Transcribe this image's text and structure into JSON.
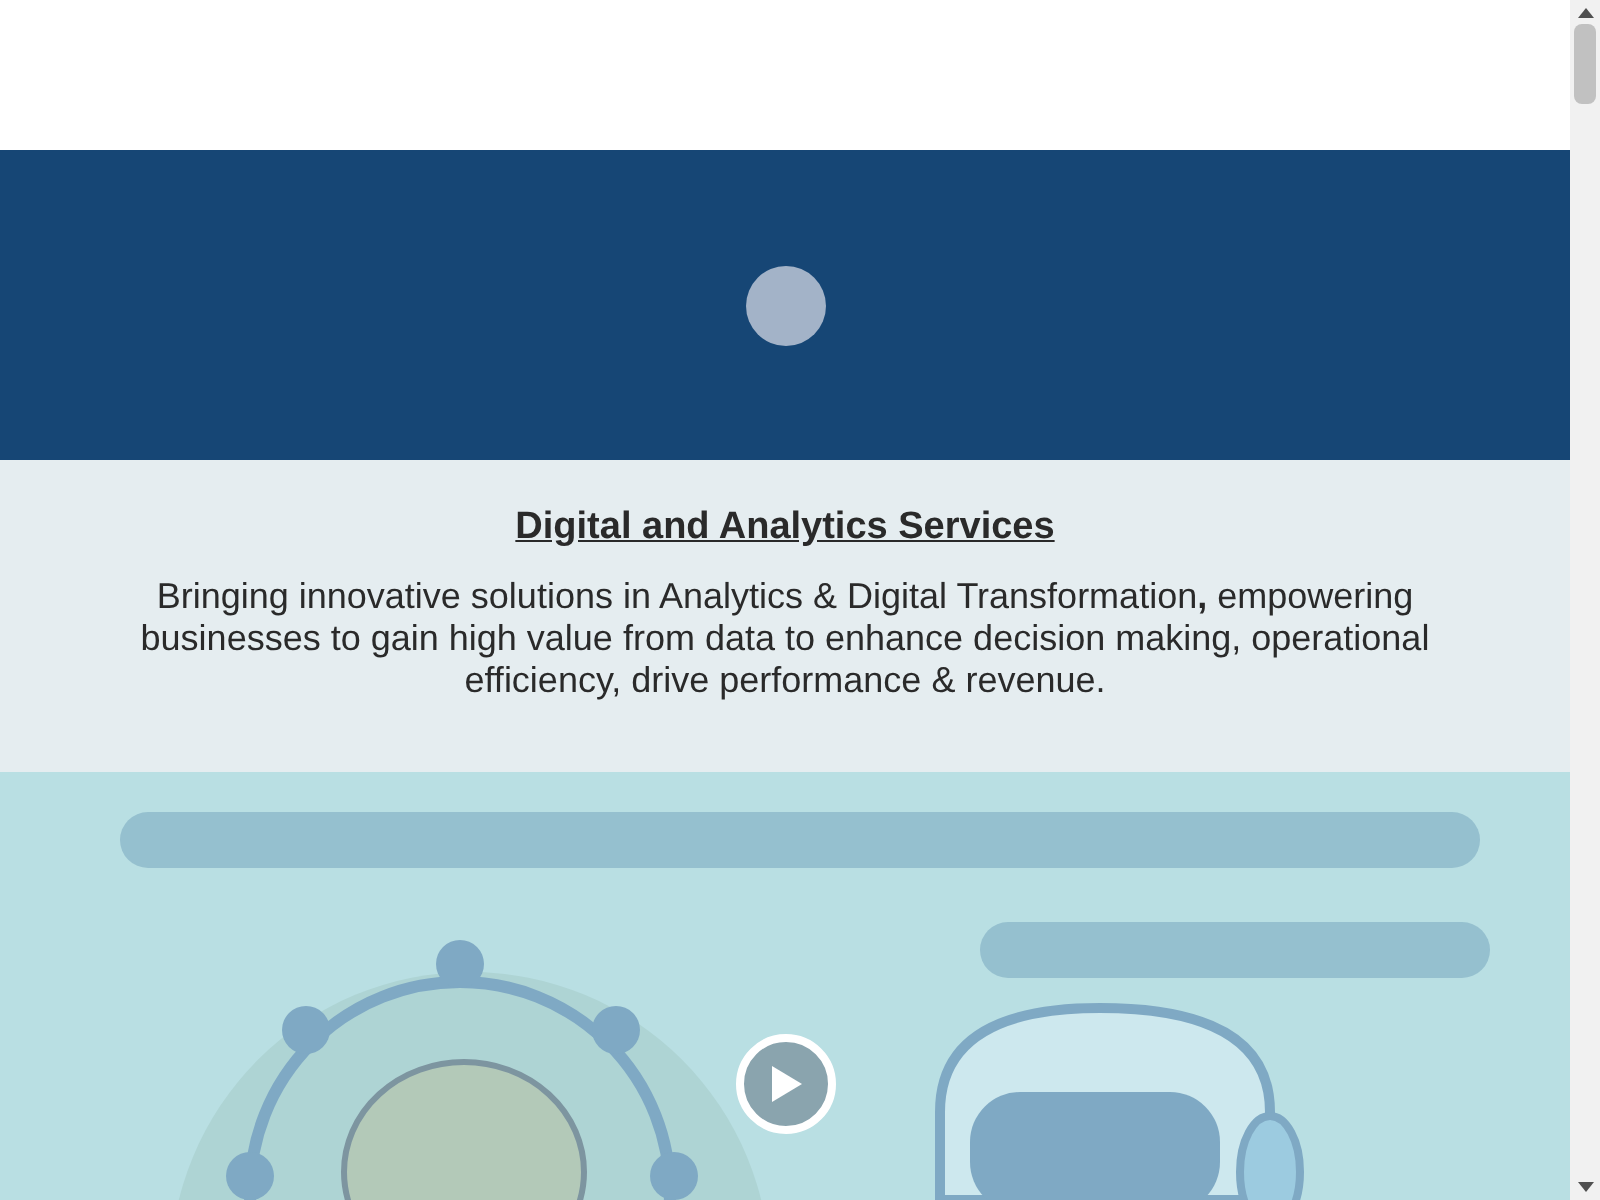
{
  "intro": {
    "title": "Digital and Analytics Services",
    "text": "Bringing innovative solutions in Analytics & Digital Transformation**,** empowering businesses to gain high value from data to enhance decision making, operational efficiency, drive performance & revenue."
  }
}
